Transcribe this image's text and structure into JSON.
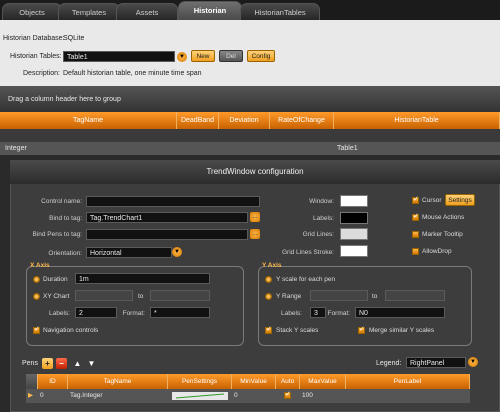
{
  "tabs": [
    {
      "label": "Objects",
      "active": false
    },
    {
      "label": "Templates",
      "active": false
    },
    {
      "label": "Assets",
      "active": false
    },
    {
      "label": "Historian",
      "active": true
    },
    {
      "label": "HistorianTables",
      "active": false
    }
  ],
  "historian": {
    "database_label": "Historian Database:",
    "database_value": "SQLite",
    "tables_label": "Historian Tables:",
    "tables_value": "Table1",
    "new_label": "New",
    "del_label": "Del",
    "config_label": "Config",
    "description_label": "Description:",
    "description_value": "Default historian table, one minute time span"
  },
  "group_hint": "Drag a column header here to group",
  "table": {
    "columns": [
      "TagName",
      "DeadBand",
      "Deviation",
      "RateOfChange",
      "HistorianTable"
    ],
    "row": {
      "tagname": "Integer",
      "historiantable": "Table1"
    }
  },
  "dialog": {
    "title": "TrendWindow configuration",
    "control_name_label": "Control name:",
    "control_name_value": "",
    "bind_tag_label": "Bind to tag:",
    "bind_tag_value": "Tag.TrendChart1",
    "bind_pens_label": "Bind Pens to tag:",
    "bind_pens_value": "",
    "orientation_label": "Orientation:",
    "orientation_value": "Horizontal",
    "window_label": "Window:",
    "labels_label": "Labels:",
    "grid_lines_label": "Grid Lines:",
    "grid_lines_stroke_label": "Grid Lines Stroke:",
    "cursor_label": "Cursor",
    "settings_label": "Settings",
    "mouse_actions_label": "Mouse Actions",
    "marker_tooltip_label": "Marker Tooltip",
    "allow_drop_label": "AllowDrop",
    "colors": {
      "window": "#ffffff",
      "labels": "#000000",
      "grid_lines": "#dcdcdc",
      "grid_stroke": "#ffffff"
    },
    "xaxis": {
      "title": "X Axis",
      "duration_label": "Duration",
      "duration_value": "1m",
      "xy_chart_label": "XY Chart",
      "to_label": "to",
      "labels_label": "Labels:",
      "labels_value": "2",
      "format_label": "Format:",
      "format_value": "*",
      "nav_label": "Navigation controls"
    },
    "yaxis": {
      "title": "Y Axis",
      "scale_each_label": "Y scale for each pen",
      "range_label": "Y Range",
      "to_label": "to",
      "labels_label": "Labels:",
      "labels_value": "3",
      "format_label": "Format:",
      "format_value": "N0",
      "stack_label": "Stack Y scales",
      "merge_label": "Merge similar Y scales"
    },
    "pens_label": "Pens",
    "legend_label": "Legend:",
    "legend_value": "RightPanel",
    "pen_columns": [
      "ID",
      "TagName",
      "PenSettings",
      "MinValue",
      "Auto",
      "MaxValue",
      "PenLabel"
    ],
    "pen_row": {
      "id": "0",
      "tagname": "Tag.Integer",
      "minvalue": "0",
      "maxvalue": "100"
    }
  }
}
